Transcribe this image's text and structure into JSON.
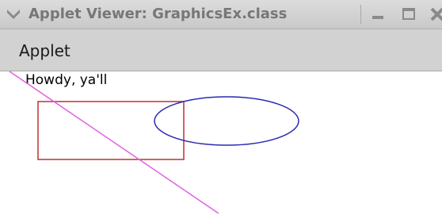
{
  "window": {
    "title": "Applet Viewer: GraphicsEx.class"
  },
  "menubar": {
    "items": [
      {
        "label": "Applet"
      }
    ]
  },
  "applet": {
    "greeting": "Howdy, ya'll",
    "colors": {
      "line": "#e060e0",
      "rectangle": "#c03030",
      "ellipse": "#2a2ab0"
    }
  }
}
